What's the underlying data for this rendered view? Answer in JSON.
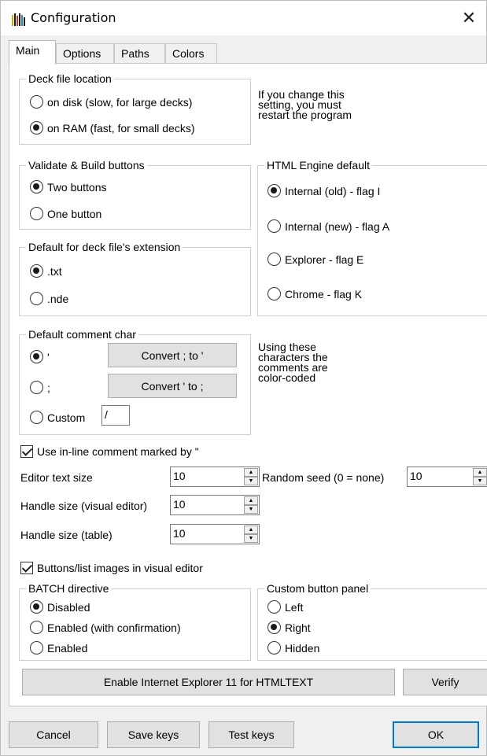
{
  "window": {
    "title": "Configuration",
    "close_glyph": "✕"
  },
  "tabs": [
    {
      "label": "Main",
      "active": true
    },
    {
      "label": "Options",
      "active": false
    },
    {
      "label": "Paths",
      "active": false
    },
    {
      "label": "Colors",
      "active": false
    }
  ],
  "deck_location": {
    "label": "Deck file location",
    "options": [
      {
        "label": "on disk (slow, for large decks)",
        "selected": false
      },
      {
        "label": "on RAM (fast, for small decks)",
        "selected": true
      }
    ],
    "note": [
      "If you change this",
      "setting, you must",
      "restart the program"
    ]
  },
  "validate_build": {
    "label": "Validate & Build buttons",
    "options": [
      {
        "label": "Two buttons",
        "selected": true
      },
      {
        "label": "One button",
        "selected": false
      }
    ]
  },
  "html_engine": {
    "label": "HTML Engine default",
    "options": [
      {
        "label": "Internal (old) - flag I",
        "selected": true
      },
      {
        "label": "Internal (new) - flag A",
        "selected": false
      },
      {
        "label": "Explorer - flag E",
        "selected": false
      },
      {
        "label": "Chrome - flag K",
        "selected": false
      }
    ]
  },
  "extension": {
    "label": "Default for deck file's extension",
    "options": [
      {
        "label": ".txt",
        "selected": true
      },
      {
        "label": ".nde",
        "selected": false
      }
    ]
  },
  "comment_char": {
    "label": "Default comment char",
    "options": [
      {
        "label": "'",
        "selected": true
      },
      {
        "label": ";",
        "selected": false
      },
      {
        "label": "Custom",
        "selected": false
      }
    ],
    "convert_semicolon_label": "Convert ; to '",
    "convert_quote_label": "Convert ' to ;",
    "custom_value": "/",
    "note": [
      "Using these",
      "characters the",
      "comments are",
      "color-coded"
    ]
  },
  "inline_comment": {
    "label": "Use in-line comment marked by \"",
    "checked": true
  },
  "editor_text_size": {
    "label": "Editor text size",
    "value": "10"
  },
  "random_seed": {
    "label": "Random seed (0 = none)",
    "value": "10"
  },
  "handle_size_visual": {
    "label": "Handle size (visual editor)",
    "value": "10"
  },
  "handle_size_table": {
    "label": "Handle size (table)",
    "value": "10"
  },
  "buttons_images": {
    "label": "Buttons/list images in visual editor",
    "checked": true
  },
  "batch": {
    "label": "BATCH directive",
    "options": [
      {
        "label": "Disabled",
        "selected": true
      },
      {
        "label": "Enabled (with confirmation)",
        "selected": false
      },
      {
        "label": "Enabled",
        "selected": false
      }
    ]
  },
  "custom_panel": {
    "label": "Custom button panel",
    "options": [
      {
        "label": "Left",
        "selected": false
      },
      {
        "label": "Right",
        "selected": true
      },
      {
        "label": "Hidden",
        "selected": false
      }
    ]
  },
  "enable_ie_label": "Enable Internet Explorer 11 for HTMLTEXT",
  "verify_label": "Verify",
  "footer": {
    "cancel_label": "Cancel",
    "save_keys_label": "Save keys",
    "test_keys_label": "Test keys",
    "ok_label": "OK"
  },
  "colors": {
    "accent": "#0078d7",
    "button_face": "#e1e1e1",
    "dialog_bg": "#f0f0f0"
  }
}
